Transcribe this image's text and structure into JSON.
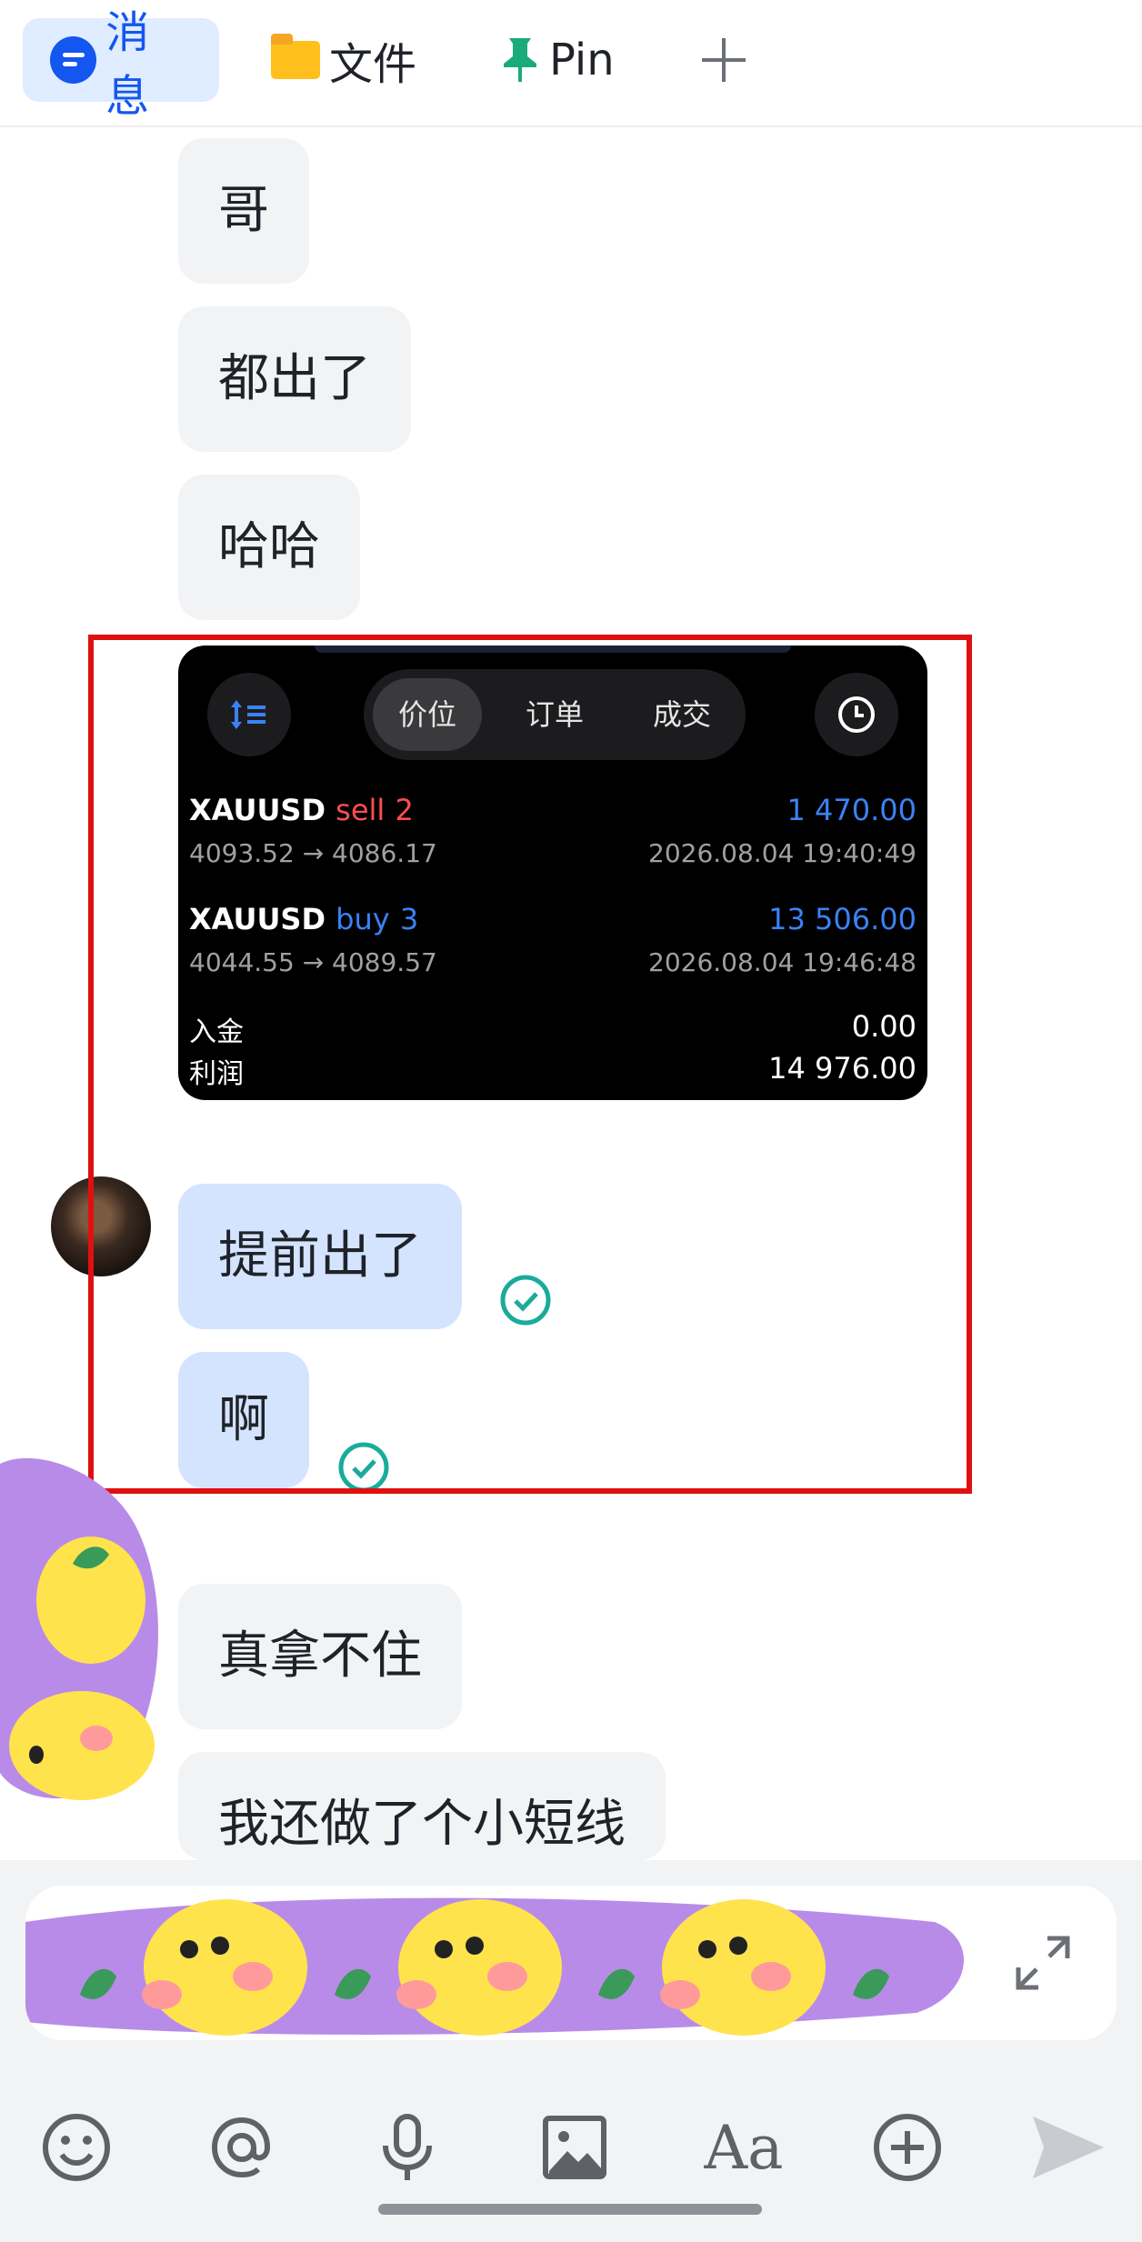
{
  "tabs": [
    {
      "label": "消息",
      "icon": "message-icon",
      "active": true
    },
    {
      "label": "文件",
      "icon": "folder-icon",
      "active": false
    },
    {
      "label": "Pin",
      "icon": "pin-icon",
      "active": false
    },
    {
      "label": "+",
      "icon": "add-icon",
      "active": false
    }
  ],
  "messages": [
    {
      "text": "哥",
      "from": "other"
    },
    {
      "text": "都出了",
      "from": "other"
    },
    {
      "text": "哈哈",
      "from": "other"
    },
    {
      "text": "提前出了",
      "from": "me",
      "status": "read"
    },
    {
      "text": "啊",
      "from": "me",
      "status": "read"
    },
    {
      "text": "真拿不住",
      "from": "other"
    },
    {
      "text": "我还做了个小短线",
      "from": "other"
    }
  ],
  "trade_screenshot": {
    "segments": [
      "价位",
      "订单",
      "成交"
    ],
    "selected_segment": "价位",
    "trades": [
      {
        "symbol": "XAUUSD",
        "side": "sell",
        "volume": "2",
        "profit": "1 470.00",
        "prices": "4093.52 → 4086.17",
        "time": "2026.08.04 19:40:49"
      },
      {
        "symbol": "XAUUSD",
        "side": "buy",
        "volume": "3",
        "profit": "13 506.00",
        "prices": "4044.55 → 4089.57",
        "time": "2026.08.04 19:46:48"
      }
    ],
    "summary": [
      {
        "label": "入金",
        "value": "0.00"
      },
      {
        "label": "利润",
        "value": "14 976.00"
      }
    ]
  },
  "composer": {
    "expand_icon": "expand-icon",
    "tools": [
      "emoji-icon",
      "mention-icon",
      "microphone-icon",
      "image-icon",
      "text-format-icon",
      "add-circle-icon",
      "send-icon"
    ],
    "text_format_label": "Aa"
  },
  "colors": {
    "accent": "#1456f0",
    "highlight_border": "#e01010",
    "read_check": "#1aab9b",
    "bubble_mine": "#d4e4ff",
    "bubble_other": "#f2f3f5"
  }
}
